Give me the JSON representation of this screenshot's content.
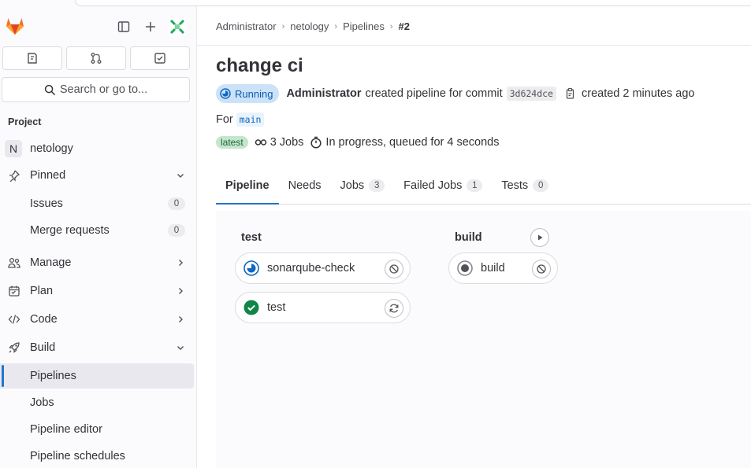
{
  "sidebar": {
    "search_label": "Search or go to...",
    "section_title": "Project",
    "project": {
      "avatar_letter": "N",
      "name": "netology"
    },
    "items": {
      "pinned": "Pinned",
      "issues": {
        "label": "Issues",
        "count": "0"
      },
      "merge_requests": {
        "label": "Merge requests",
        "count": "0"
      },
      "manage": "Manage",
      "plan": "Plan",
      "code": "Code",
      "build": "Build",
      "pipelines": "Pipelines",
      "jobs": "Jobs",
      "pipeline_editor": "Pipeline editor",
      "pipeline_schedules": "Pipeline schedules"
    }
  },
  "breadcrumb": [
    "Administrator",
    "netology",
    "Pipelines",
    "#2"
  ],
  "pipeline": {
    "title": "change ci",
    "status": "Running",
    "author": "Administrator",
    "action_text": "created pipeline for commit",
    "commit_sha": "3d624dce",
    "created_text": "created 2 minutes ago",
    "for_text": "For",
    "ref": "main",
    "latest_badge": "latest",
    "jobs_text": "3 Jobs",
    "progress_text": "In progress, queued for 4 seconds"
  },
  "tabs": [
    {
      "label": "Pipeline",
      "count": ""
    },
    {
      "label": "Needs",
      "count": ""
    },
    {
      "label": "Jobs",
      "count": "3"
    },
    {
      "label": "Failed Jobs",
      "count": "1"
    },
    {
      "label": "Tests",
      "count": "0"
    }
  ],
  "stages": [
    {
      "name": "test",
      "jobs": [
        {
          "name": "sonarqube-check",
          "status": "running"
        },
        {
          "name": "test",
          "status": "success"
        }
      ]
    },
    {
      "name": "build",
      "jobs": [
        {
          "name": "build",
          "status": "created"
        }
      ]
    }
  ],
  "colors": {
    "accent": "#1f75cb",
    "running_bg": "#cbe2f9",
    "success": "#108548",
    "latest_bg": "#c3e6cd",
    "logo": "#e24329"
  }
}
